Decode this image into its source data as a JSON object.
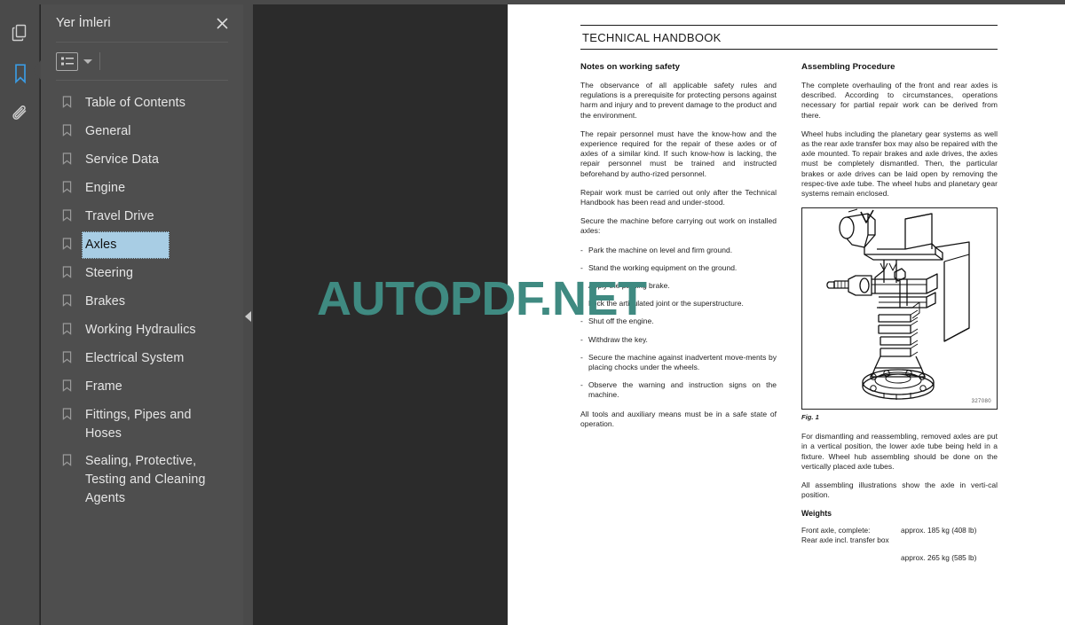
{
  "rail": {
    "items": [
      {
        "name": "page-thumbnails-icon",
        "title": "Page Thumbnails",
        "active": false
      },
      {
        "name": "bookmarks-icon",
        "title": "Bookmarks",
        "active": true
      },
      {
        "name": "attachments-icon",
        "title": "Attachments",
        "active": false
      }
    ],
    "active_color": "#3b9ae1"
  },
  "bookmarks_panel": {
    "title": "Yer İmleri",
    "close_label": "✕",
    "toolbar": {
      "options_icon": "list-options-icon",
      "caret_icon": "chevron-down-icon"
    },
    "selected_index": 5,
    "selection_color": "#a8cde4",
    "items": [
      {
        "label": "Table of Contents"
      },
      {
        "label": "General"
      },
      {
        "label": "Service Data"
      },
      {
        "label": "Engine"
      },
      {
        "label": "Travel Drive"
      },
      {
        "label": "Axles"
      },
      {
        "label": "Steering"
      },
      {
        "label": "Brakes"
      },
      {
        "label": "Working Hydraulics"
      },
      {
        "label": "Electrical System"
      },
      {
        "label": "Frame"
      },
      {
        "label": "Fittings, Pipes and Hoses"
      },
      {
        "label": "Sealing, Protective, Testing and Cleaning Agents"
      }
    ]
  },
  "divider": {
    "collapse_icon": "chevron-left-icon"
  },
  "viewer": {
    "cursor_icon": "marquee-select-cursor",
    "watermark": "AUTOPDF.NET",
    "watermark_color": "#3f8a81"
  },
  "document": {
    "running_head": "TECHNICAL HANDBOOK",
    "left_column": {
      "heading": "Notes on working safety",
      "paragraphs": [
        "The observance of all applicable safety rules and regulations is a prerequisite for protecting persons against harm and injury and to prevent damage to the product and the environment.",
        "The repair personnel must have the know-how and the experience required for the repair of these axles or of axles of a similar kind. If such know-how is lacking, the repair personnel must be trained and instructed beforehand by autho-rized personnel.",
        "Repair work must be carried out only after the Technical Handbook has been read and under-stood.",
        "Secure the machine before carrying out work on installed axles:"
      ],
      "bullets": [
        "Park the machine on level and firm ground.",
        "Stand the working equipment on the ground.",
        "Apply the parking brake.",
        "Lock the articulated joint or the superstructure.",
        "Shut off the engine.",
        "Withdraw the key.",
        "Secure the machine against inadvertent move-ments by placing chocks under the wheels.",
        "Observe the warning and instruction signs on the machine."
      ],
      "closing": "All tools and auxiliary means must be in a safe state of operation."
    },
    "right_column": {
      "heading": "Assembling Procedure",
      "paragraphs": [
        "The complete overhauling of the front and rear axles is described. According to circumstances, operations necessary for partial repair work can be derived from there.",
        "Wheel hubs including the planetary gear systems as well as the rear axle transfer box may also be repaired with the axle mounted. To repair brakes and axle drives, the axles must be completely dismantled. Then, the particular brakes or axle drives can be laid open by removing the respec-tive axle tube. The wheel hubs and planetary gear systems remain enclosed."
      ],
      "figure": {
        "number": "327080",
        "caption": "Fig. 1",
        "alt": "axle-assembly-drawing"
      },
      "paragraphs_after": [
        "For dismantling and reassembling, removed axles are put in a vertical position, the lower axle tube being held in a fixture. Wheel hub assembling should be done on the vertically placed axle tubes.",
        "All assembling illustrations show the axle in verti-cal position."
      ],
      "weights": {
        "heading": "Weights",
        "row1_label": "Front axle, complete:",
        "row1_value": "approx. 185 kg (408 lb)",
        "row2_label": "Rear axle incl. transfer box",
        "row2_value": "approx. 265 kg (585 lb)"
      }
    }
  }
}
